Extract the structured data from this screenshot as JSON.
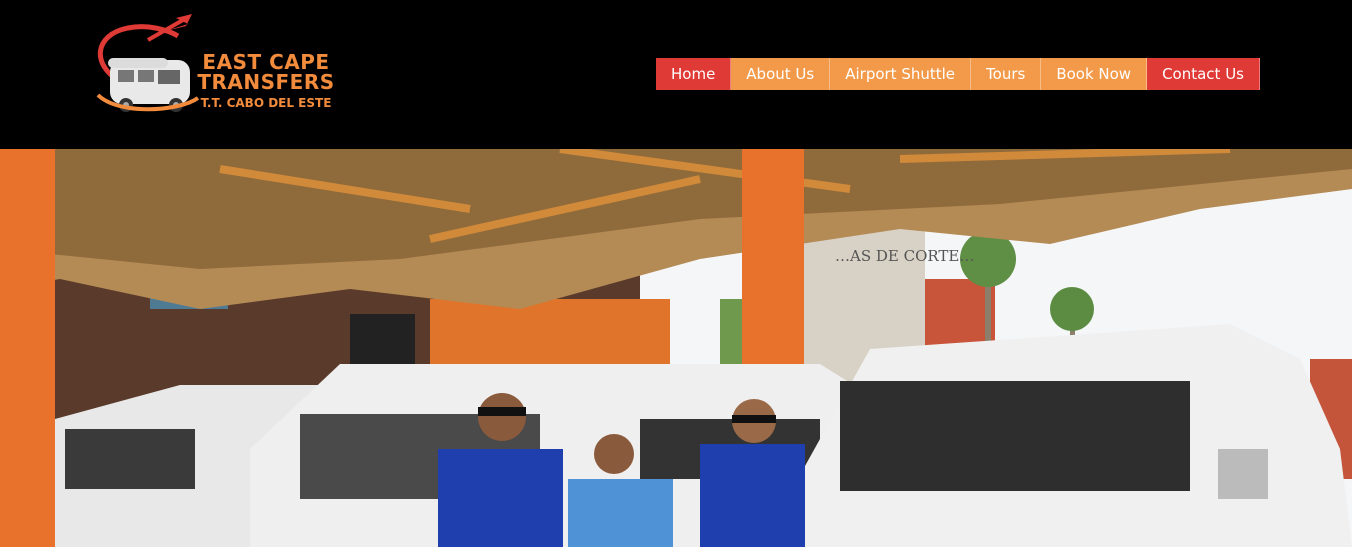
{
  "brand": {
    "line1": "EAST CAPE",
    "line2": "TRANSFERS",
    "line3": "T.T. CABO DEL ESTE"
  },
  "nav": {
    "items": [
      {
        "label": "Home",
        "state": "active"
      },
      {
        "label": "About Us",
        "state": "normal"
      },
      {
        "label": "Airport Shuttle",
        "state": "normal"
      },
      {
        "label": "Tours",
        "state": "normal"
      },
      {
        "label": "Book Now",
        "state": "normal"
      },
      {
        "label": "Contact Us",
        "state": "highlight"
      }
    ]
  },
  "hero": {
    "image": "hero-photo",
    "building_sign": "…AS DE CORTE…"
  },
  "colors": {
    "header_bg": "#000000",
    "nav_active": "#e03a36",
    "nav_orange": "#f29a4a",
    "logo_orange": "#f28b3c"
  }
}
